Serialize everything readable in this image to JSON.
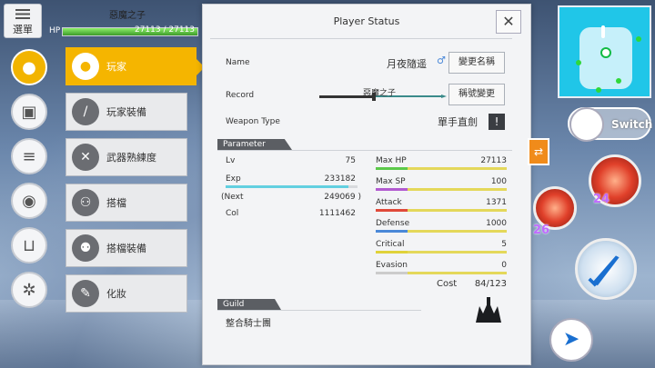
{
  "hud": {
    "menu_label": "選單",
    "char_name": "惡魔之子",
    "hp_label": "HP",
    "hp_text": "27113 / 27113",
    "hp_fill": 1.0
  },
  "panel": {
    "title": "Player Status",
    "name_label": "Name",
    "name_value": "月夜隨遥",
    "gender": "♂",
    "rename_button": "變更名稱",
    "record_label": "Record",
    "record_value": "惡魔之子",
    "record_button": "稱號變更",
    "weapon_label": "Weapon Type",
    "weapon_value": "單手直劍",
    "param_tab": "Parameter",
    "left": [
      {
        "label": "Lv",
        "value": "75"
      },
      {
        "label": "Exp",
        "value": "233182"
      },
      {
        "label": "(Next",
        "value": "249069 )"
      },
      {
        "label": "Col",
        "value": "1111462"
      }
    ],
    "exp_fill": 0.93,
    "right": [
      {
        "label": "Max HP",
        "value": "27113",
        "color": "#5cc94a"
      },
      {
        "label": "Max SP",
        "value": "100",
        "color": "#b25ad0"
      },
      {
        "label": "Attack",
        "value": "1371",
        "color": "#e04a3a"
      },
      {
        "label": "Defense",
        "value": "1000",
        "color": "#4a88d8"
      },
      {
        "label": "Critical",
        "value": "5",
        "color": "#e0d23a"
      },
      {
        "label": "Evasion",
        "value": "0",
        "color": "#cccccc"
      }
    ],
    "cost_label": "Cost",
    "cost_value": "84/123",
    "guild_tab": "Guild",
    "guild_value": "整合騎士團"
  },
  "submenu": [
    {
      "label": "玩家",
      "icon": "person-icon",
      "active": true
    },
    {
      "label": "玩家裝備",
      "icon": "sword-icon",
      "active": false
    },
    {
      "label": "武器熟練度",
      "icon": "crossed-swords-icon",
      "active": false
    },
    {
      "label": "搭檔",
      "icon": "partner-icon",
      "active": false
    },
    {
      "label": "搭檔裝備",
      "icon": "partner-equip-icon",
      "active": false
    },
    {
      "label": "化妝",
      "icon": "makeup-icon",
      "active": false
    }
  ],
  "right_hud": {
    "switch_label": "Switch",
    "skill_num_1": "24",
    "skill_num_2": "26"
  }
}
